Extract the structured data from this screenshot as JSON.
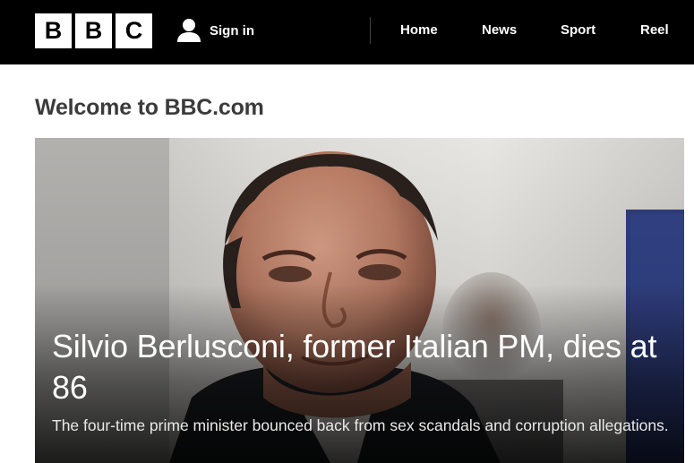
{
  "header": {
    "logo_letters": [
      "B",
      "B",
      "C"
    ],
    "signin_label": "Sign in",
    "nav": [
      {
        "label": "Home"
      },
      {
        "label": "News"
      },
      {
        "label": "Sport"
      },
      {
        "label": "Reel"
      }
    ]
  },
  "main": {
    "title": "Welcome to BBC.com",
    "hero": {
      "headline": "Silvio Berlusconi, former Italian PM, dies at 86",
      "summary": "The four-time prime minister bounced back from sex scandals and corruption allegations."
    }
  },
  "colors": {
    "header_background": "#000000",
    "logo_box": "#ffffff",
    "title_text": "#3b3b3b",
    "hero_text": "#ffffff"
  }
}
